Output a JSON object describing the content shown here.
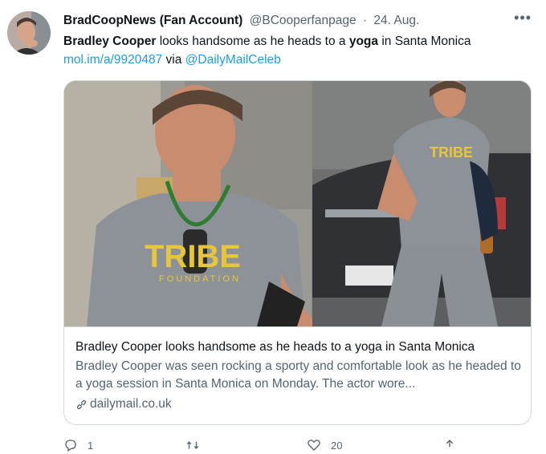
{
  "tweet": {
    "display_name": "BradCoopNews (Fan Account)",
    "handle": "@BCooperfanpage",
    "separator": "·",
    "date": "24. Aug.",
    "more_icon": "ellipsis-icon",
    "text": {
      "part1_bold": "Bradley Cooper",
      "part2": " looks handsome as he heads to a ",
      "part3_bold": "yoga",
      "part4": " in Santa Monica",
      "link": "mol.im/a/9920487",
      "via": " via ",
      "mention": "@DailyMailCeleb"
    },
    "link_color": "#1d9bf0"
  },
  "card": {
    "image_alt_subject": "Tribe Foundation",
    "title": "Bradley Cooper looks handsome as he heads to a yoga in Santa Monica",
    "description": "Bradley Cooper was seen rocking a sporty and comfortable look as he headed to a yoga session in Santa Monica on Monday. The actor wore...",
    "domain": "dailymail.co.uk",
    "domain_icon": "link-icon"
  },
  "actions": {
    "reply_count": "1",
    "retweet_count": "",
    "like_count": "20",
    "share_count": ""
  }
}
